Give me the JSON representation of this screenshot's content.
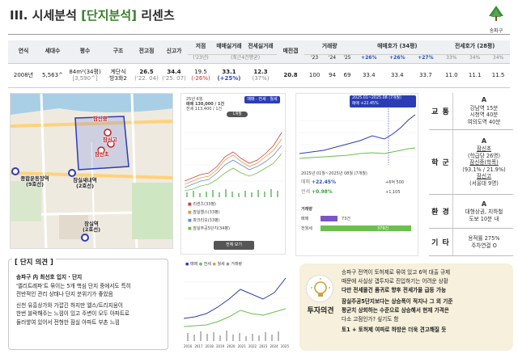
{
  "header": {
    "title_prefix": "III. 시세분석 ",
    "title_highlight": "[단지분석]",
    "title_suffix": " 리센츠",
    "logo_label": "송파구"
  },
  "summary": {
    "headers": [
      "연식",
      "세대수",
      "평수",
      "구조",
      "전고점",
      "신고가",
      "저점",
      "매매실거래",
      "전세실거래",
      "매전갭",
      "거래량",
      "매매호가 (34평)",
      "전세호가 (28평)"
    ],
    "sub": {
      "low": "('23년)",
      "recent": "(최근4건평균)",
      "years": [
        "'23",
        "'24",
        "'25"
      ],
      "sale_changes": [
        "+26%",
        "+26%",
        "+27%"
      ],
      "rent_changes": [
        "33%",
        "34%",
        "34%"
      ]
    },
    "row": {
      "year": "2008년",
      "households": "5,563^",
      "size_main": "84m²(34평)",
      "size_sub": "[3,590^]",
      "structure_1": "계단식",
      "structure_2": "방3화2",
      "prev_high": "26.5",
      "prev_high_date": "('22. 04)",
      "new_high": "34.4",
      "new_high_date": "('25. 07)",
      "low": "19.5",
      "low_change": "(-26%)",
      "sale": "33.1",
      "sale_change": "(+25%)",
      "rent": "12.3",
      "rent_ratio": "(37%)",
      "gap": "20.8",
      "volume": [
        "100",
        "94",
        "69"
      ],
      "sale_quote": [
        "33.4",
        "33.4",
        "33.7"
      ],
      "rent_quote": [
        "11.0",
        "11.1",
        "11.5"
      ]
    }
  },
  "map": {
    "labels": {
      "jamsil_middle": "잠신중",
      "jamsil_high": "잠신고",
      "jamsil_elem": "잠신초",
      "sports_station": "종합운동장역\n(9호선)",
      "saenae_station": "잠실새내역\n(2호선)",
      "jamsil_station": "잠실역\n(2호선)"
    }
  },
  "panel1": {
    "line1": "25년 6월",
    "price": "매매 130,000 / 1건",
    "price2": "전세 113,400 / 1건",
    "tabs": [
      "매매",
      "전세",
      "월세"
    ],
    "tab2": "1개월",
    "legend": [
      "리센츠(33평)",
      "잠실엘스(33평)",
      "파크리오(33평)",
      "잠실주공5단지(34평)"
    ],
    "button": "전체 보기"
  },
  "panel2": {
    "period": "2025.01~2025.08 (7개월)",
    "stat1": "매매 +22.45%",
    "stat2": "전세 +0.98%",
    "range": "2025년 01월~2025년 08월 (7개월)",
    "sale_label": "매매",
    "sale_change": "+22.45%",
    "sale_count": "+6억 500",
    "rent_label": "전세",
    "rent_change": "+0.98%",
    "rent_count": "+1,105",
    "volume_title": "거래량",
    "bars": [
      {
        "name": "매매",
        "value": "73건",
        "pct": 0.19
      },
      {
        "name": "전월세",
        "value": "379건",
        "pct": 1.0
      }
    ]
  },
  "info": [
    {
      "cat": "교 통",
      "grade": "A",
      "lines": [
        "강남역 15분",
        "시청역 40분",
        "여의도역 40분"
      ]
    },
    {
      "cat": "학 군",
      "grade": "A",
      "lines": [
        "잠신초",
        "(학급당 26명)",
        "잠신중(학폭)",
        "(93.1% / 21.9%)",
        "잠신고",
        "(서울대 9명)"
      ]
    },
    {
      "cat": "환 경",
      "grade": "A",
      "lines": [
        "대형상권, 지하철",
        "도보 10분 내"
      ]
    },
    {
      "cat": "기 타",
      "grade": "",
      "lines": [
        "용적률 275%",
        "주차연결 O"
      ]
    }
  ],
  "opinion": {
    "heading": "[ 단지 의견 ]",
    "lines": [
      "송파구 内 최선호 입지 · 단지",
      "'엘리트레파'트 묶이는 5개 핵심 단지 중에서도 특히",
      "전반적인 관리 상태나 단지 분위기가 좋았음",
      "신천 유흥상가와 가깝긴 하지만 엘스/트리지움이",
      "한번 블락해주는 느낌이 있고 주변이 모두 아파트로",
      "둘러쌓여 있어서 전형한 잠실 아파트 부촌 느낌"
    ]
  },
  "chart3": {
    "legend": [
      "매매",
      "전세",
      "월세",
      "거래량"
    ],
    "x_labels": [
      "2016",
      "2017",
      "2018",
      "2019",
      "2020",
      "2021",
      "2022",
      "2023",
      "2024",
      "2025"
    ]
  },
  "invest": {
    "label": "투자의견",
    "lines": [
      "송파구 전역이 토허제로 묶여 있고 6억 대출 규제",
      "때문에 사실상 갭투자로 진입하기는 어려운 상황",
      "다만 전세물건 품귀로 향후 전세가율 급등 가능",
      "잠실주공5단지보다는 상승폭이 적지나 그 외 기준",
      "평균치 상회하는 수준으로 상승해서 현재 가격은",
      "다소 고점인가? 싶기도 함",
      "토1 + 토허제 여파로 하방은 더욱 견고해질 듯"
    ]
  },
  "colors": {
    "accent": "#3a7d2c",
    "sale": "#2c3cb5",
    "rent": "#6bbf4d"
  }
}
